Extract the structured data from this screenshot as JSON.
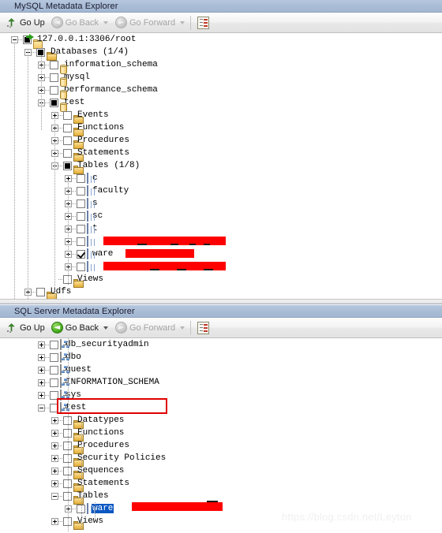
{
  "panel1": {
    "title": "MySQL Metadata Explorer",
    "toolbar": {
      "go_up": "Go Up",
      "go_back": "Go Back",
      "go_forward": "Go Forward",
      "go_up_icon": "arrow-up-icon",
      "go_back_icon": "circle-left-arrow-icon",
      "go_forward_icon": "circle-right-arrow-icon",
      "report_icon": "report-icon",
      "go_back_enabled": false,
      "go_forward_enabled": false
    },
    "tree": [
      {
        "label": "127.0.0.1:3306/root",
        "icon": "server-icon",
        "depth": 0,
        "expander": "minus",
        "checkbox": "filled"
      },
      {
        "label": "Databases (1/4)",
        "icon": "folder-icon",
        "depth": 1,
        "expander": "minus",
        "checkbox": "filled"
      },
      {
        "label": "information_schema",
        "icon": "database-icon",
        "depth": 2,
        "expander": "plus",
        "checkbox": "empty"
      },
      {
        "label": "mysql",
        "icon": "database-icon",
        "depth": 2,
        "expander": "plus",
        "checkbox": "empty"
      },
      {
        "label": "performance_schema",
        "icon": "database-icon",
        "depth": 2,
        "expander": "plus",
        "checkbox": "empty"
      },
      {
        "label": "test",
        "icon": "database-icon",
        "depth": 2,
        "expander": "minus",
        "checkbox": "filled"
      },
      {
        "label": "Events",
        "icon": "folder-icon",
        "depth": 3,
        "expander": "plus",
        "checkbox": "empty"
      },
      {
        "label": "Functions",
        "icon": "folder-icon",
        "depth": 3,
        "expander": "plus",
        "checkbox": "empty"
      },
      {
        "label": "Procedures",
        "icon": "folder-icon",
        "depth": 3,
        "expander": "plus",
        "checkbox": "empty"
      },
      {
        "label": "Statements",
        "icon": "folder-icon",
        "depth": 3,
        "expander": "plus",
        "checkbox": "empty"
      },
      {
        "label": "Tables (1/8)",
        "icon": "folder-icon",
        "depth": 3,
        "expander": "minus",
        "checkbox": "filled"
      },
      {
        "label": "c",
        "icon": "table-icon",
        "depth": 4,
        "expander": "plus",
        "checkbox": "empty"
      },
      {
        "label": "faculty",
        "icon": "table-icon",
        "depth": 4,
        "expander": "plus",
        "checkbox": "empty"
      },
      {
        "label": "s",
        "icon": "table-icon",
        "depth": 4,
        "expander": "plus",
        "checkbox": "empty"
      },
      {
        "label": "sc",
        "icon": "table-icon",
        "depth": 4,
        "expander": "plus",
        "checkbox": "empty"
      },
      {
        "label": "t",
        "icon": "table-icon",
        "depth": 4,
        "expander": "plus",
        "checkbox": "empty"
      },
      {
        "label": "",
        "icon": "table-icon",
        "depth": 4,
        "expander": "plus",
        "checkbox": "empty",
        "redacted": true
      },
      {
        "label": "ware",
        "icon": "table-icon",
        "depth": 4,
        "expander": "plus",
        "checkbox": "checked",
        "redacted": true
      },
      {
        "label": "",
        "icon": "table-icon",
        "depth": 4,
        "expander": "plus",
        "checkbox": "empty",
        "redacted": true
      },
      {
        "label": "Views",
        "icon": "folder-icon",
        "depth": 3,
        "expander": "none",
        "checkbox": "empty"
      },
      {
        "label": "Udfs",
        "icon": "folder-icon",
        "depth": 1,
        "expander": "plus",
        "checkbox": "empty"
      }
    ]
  },
  "panel2": {
    "title": "SQL Server Metadata Explorer",
    "toolbar": {
      "go_up": "Go Up",
      "go_back": "Go Back",
      "go_forward": "Go Forward",
      "go_up_icon": "arrow-up-icon",
      "go_back_icon": "circle-left-arrow-icon",
      "go_forward_icon": "circle-right-arrow-icon",
      "report_icon": "report-icon",
      "go_back_enabled": true,
      "go_forward_enabled": false
    },
    "tree": [
      {
        "label": "db_securityadmin",
        "icon": "schema-icon",
        "depth": 2,
        "expander": "plus",
        "checkbox": "empty"
      },
      {
        "label": "dbo",
        "icon": "schema-icon",
        "depth": 2,
        "expander": "plus",
        "checkbox": "empty"
      },
      {
        "label": "guest",
        "icon": "schema-icon",
        "depth": 2,
        "expander": "plus",
        "checkbox": "empty"
      },
      {
        "label": "INFORMATION_SCHEMA",
        "icon": "schema-icon",
        "depth": 2,
        "expander": "plus",
        "checkbox": "empty"
      },
      {
        "label": "sys",
        "icon": "schema-icon",
        "depth": 2,
        "expander": "plus",
        "checkbox": "empty"
      },
      {
        "label": "test",
        "icon": "schema-icon",
        "depth": 2,
        "expander": "minus",
        "checkbox": "empty",
        "annotated": true
      },
      {
        "label": "Datatypes",
        "icon": "folder-icon",
        "depth": 3,
        "expander": "plus",
        "checkbox": "empty"
      },
      {
        "label": "Functions",
        "icon": "folder-icon",
        "depth": 3,
        "expander": "plus",
        "checkbox": "empty"
      },
      {
        "label": "Procedures",
        "icon": "folder-icon",
        "depth": 3,
        "expander": "plus",
        "checkbox": "empty"
      },
      {
        "label": "Security Policies",
        "icon": "folder-icon",
        "depth": 3,
        "expander": "plus",
        "checkbox": "empty"
      },
      {
        "label": "Sequences",
        "icon": "folder-icon",
        "depth": 3,
        "expander": "plus",
        "checkbox": "empty"
      },
      {
        "label": "Statements",
        "icon": "folder-icon",
        "depth": 3,
        "expander": "plus",
        "checkbox": "empty"
      },
      {
        "label": "Tables",
        "icon": "folder-icon",
        "depth": 3,
        "expander": "minus",
        "checkbox": "empty"
      },
      {
        "label": "ware",
        "icon": "table-icon",
        "depth": 4,
        "expander": "plus",
        "checkbox": "empty",
        "selected": true,
        "redacted": true
      },
      {
        "label": "Views",
        "icon": "folder-icon",
        "depth": 3,
        "expander": "plus",
        "checkbox": "empty"
      }
    ]
  },
  "watermark": "https://blog.csdn.net/Leyton",
  "colors": {
    "title_bar": "#aabdd6",
    "redaction": "#fe0000",
    "annotation": "#e00000",
    "selection": "#0a57c2",
    "enabled_back": "#46ae1d"
  }
}
